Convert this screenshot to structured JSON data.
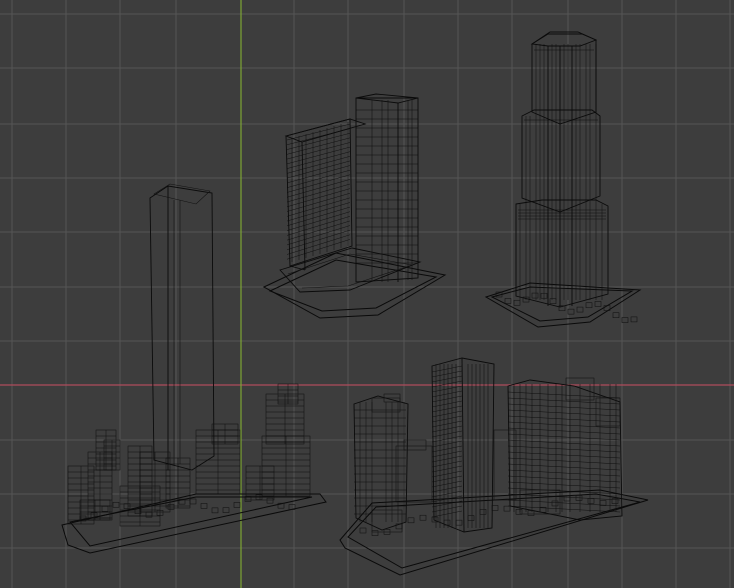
{
  "viewport": {
    "axis_x_color": "#b04c5c",
    "axis_y_color": "#7da534",
    "grid_color": "#555555",
    "background": "#3d3d3d",
    "wire_color": "#0b0b0b"
  },
  "models": [
    {
      "name": "slab-tower-with-podium"
    },
    {
      "name": "stepped-supertall-tower"
    },
    {
      "name": "tall-slender-tower-block"
    },
    {
      "name": "mixed-use-city-block"
    }
  ]
}
